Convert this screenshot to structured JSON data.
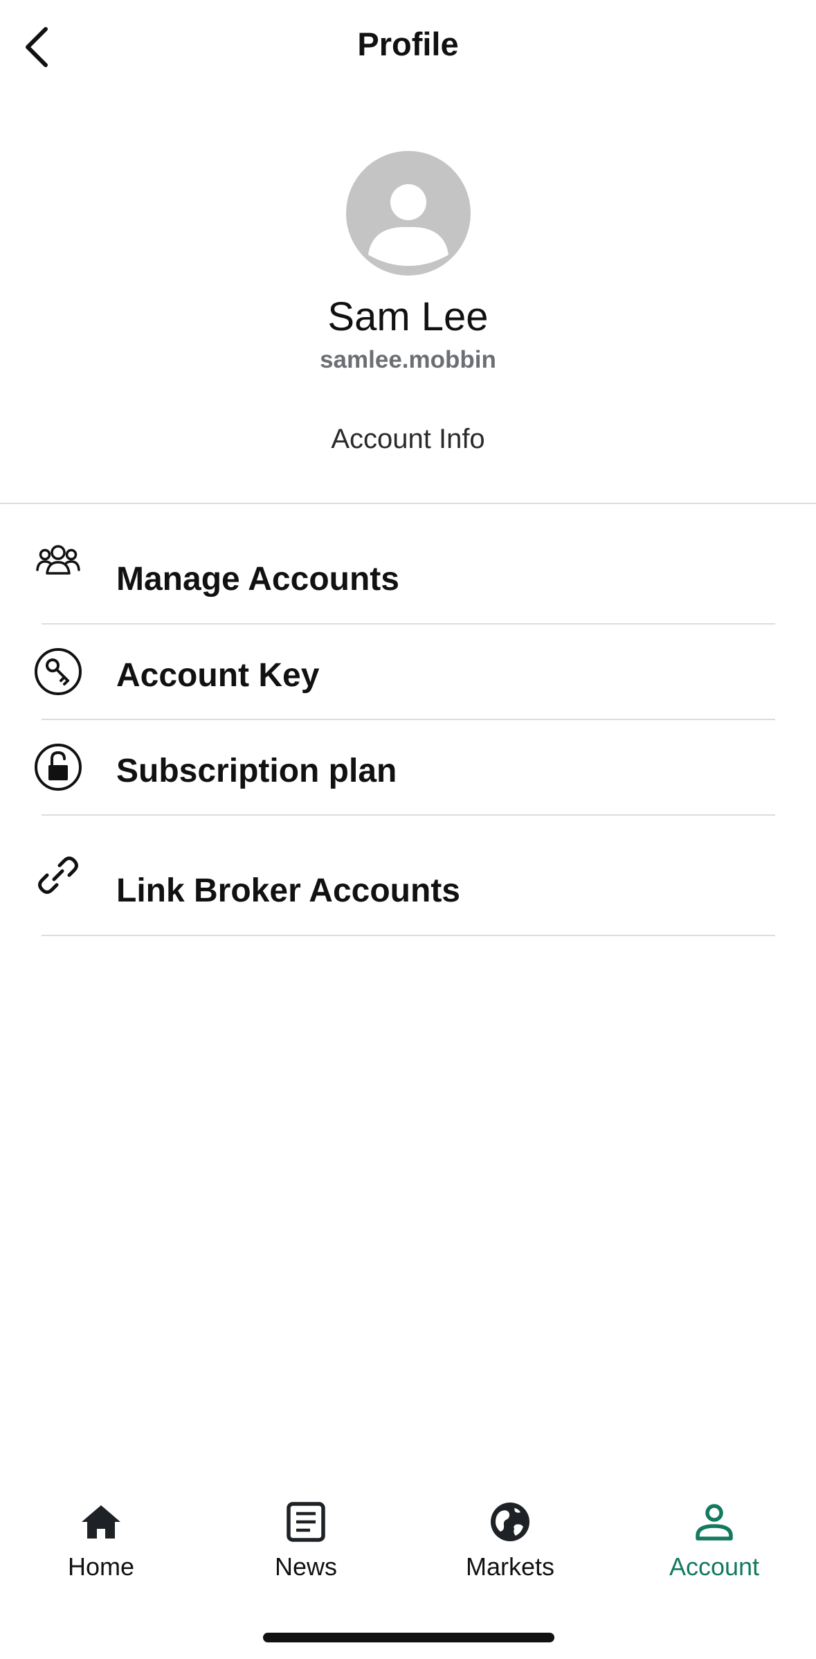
{
  "header": {
    "title": "Profile",
    "back_icon": "chevron-left-icon"
  },
  "profile": {
    "avatar_icon": "default-avatar-icon",
    "name": "Sam Lee",
    "username": "samlee.mobbin",
    "account_info_label": "Account Info"
  },
  "menu": {
    "items": [
      {
        "label": "Manage Accounts",
        "icon": "users-icon"
      },
      {
        "label": "Account Key",
        "icon": "key-icon"
      },
      {
        "label": "Subscription plan",
        "icon": "lock-icon"
      },
      {
        "label": "Link Broker Accounts",
        "icon": "link-icon"
      }
    ]
  },
  "tabbar": {
    "tabs": [
      {
        "label": "Home",
        "icon": "home-icon",
        "active": false
      },
      {
        "label": "News",
        "icon": "news-icon",
        "active": false
      },
      {
        "label": "Markets",
        "icon": "globe-icon",
        "active": false
      },
      {
        "label": "Account",
        "icon": "person-icon",
        "active": true
      }
    ],
    "active_color": "#137a5f"
  },
  "colors": {
    "text_primary": "#111111",
    "text_secondary": "#6b6f73",
    "avatar_bg": "#c4c4c4",
    "divider": "#dcdcdc"
  }
}
